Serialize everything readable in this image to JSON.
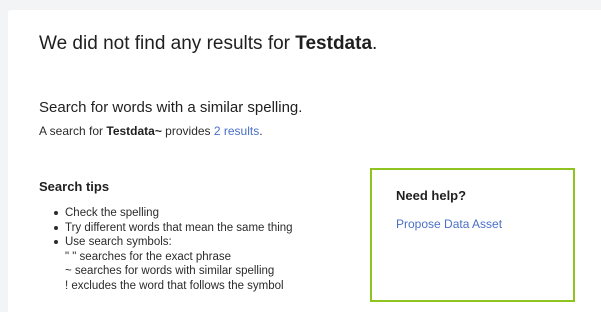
{
  "results": {
    "no_results_prefix": "We did not find any results for ",
    "query": "Testdata",
    "no_results_suffix": "."
  },
  "similar": {
    "heading": "Search for words with a similar spelling.",
    "prefix": "A search for ",
    "fuzzy_query": "Testdata~",
    "middle": " provides ",
    "results_link": "2 results",
    "suffix": "."
  },
  "tips": {
    "heading": "Search tips",
    "items": [
      "Check the spelling",
      "Try different words that mean the same thing",
      "Use search symbols:"
    ],
    "symbols": [
      "\" \" searches for the exact phrase",
      "~ searches for words with similar spelling",
      "! excludes the word that follows the symbol"
    ]
  },
  "help": {
    "heading": "Need help?",
    "link": "Propose Data Asset"
  },
  "colors": {
    "link": "#4a6fc7",
    "help_border": "#8fc31f",
    "background": "#f3f4f6"
  }
}
